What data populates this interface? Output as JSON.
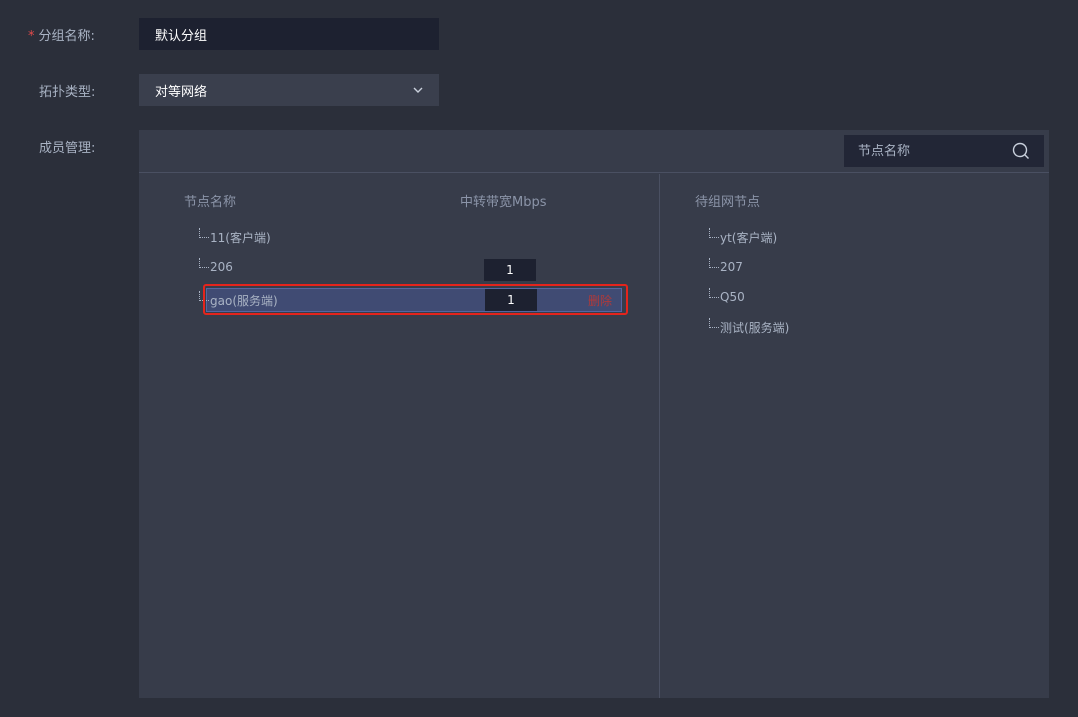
{
  "form": {
    "group_name_required": "*",
    "group_name_label": "分组名称:",
    "group_name_value": "默认分组",
    "topology_label": "拓扑类型:",
    "topology_value": "对等网络",
    "members_label": "成员管理:"
  },
  "panel": {
    "search_placeholder": "节点名称",
    "left_header_name": "节点名称",
    "left_header_bandwidth": "中转带宽Mbps",
    "right_header": "待组网节点",
    "members": [
      {
        "name": "11(客户端)",
        "bandwidth": null
      },
      {
        "name": "206",
        "bandwidth": "1"
      },
      {
        "name": "gao(服务端)",
        "bandwidth": "1",
        "action": "删除",
        "selected": true
      }
    ],
    "pending": [
      {
        "name": "yt(客户端)"
      },
      {
        "name": "207"
      },
      {
        "name": "Q50"
      },
      {
        "name": "测试(服务端)"
      }
    ]
  },
  "colors": {
    "background": "#2b2f3a",
    "panel": "#373c4a",
    "input": "#1d2130",
    "selected_row": "#404b73",
    "highlight_border": "#e4241c",
    "delete_text": "#b03a3a"
  },
  "icons": {
    "dropdown": "chevron-down-icon",
    "search": "search-icon"
  }
}
